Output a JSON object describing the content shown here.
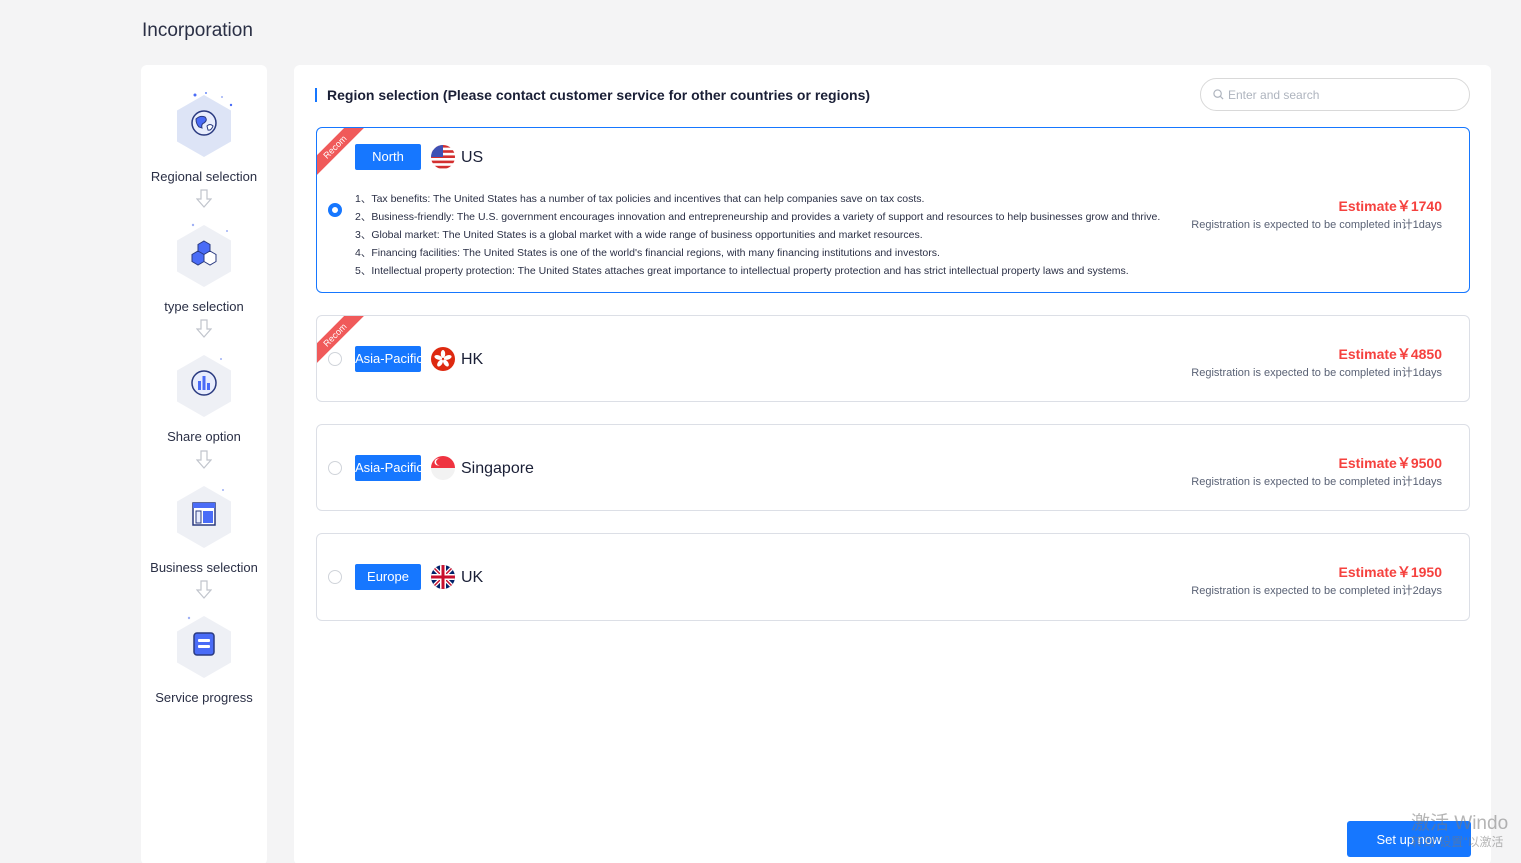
{
  "page": {
    "title": "Incorporation"
  },
  "sidebar": {
    "steps": [
      {
        "label": "Regional selection",
        "icon": "globe-icon"
      },
      {
        "label": "type selection",
        "icon": "hexagons-icon"
      },
      {
        "label": "Share option",
        "icon": "bar-chart-icon"
      },
      {
        "label": "Business selection",
        "icon": "layout-icon"
      },
      {
        "label": "Service progress",
        "icon": "document-icon"
      }
    ]
  },
  "main": {
    "section_title": "Region selection (Please contact customer service for other countries or regions)",
    "search": {
      "placeholder": "Enter and search",
      "value": ""
    },
    "ribbon_text": "Recom",
    "regions": [
      {
        "tag": "North",
        "country": "US",
        "flag": "us-flag-icon",
        "recommended": true,
        "selected": true,
        "details": [
          "1、Tax benefits: The United States has a number of tax policies and incentives that can help companies save on tax costs.",
          "2、Business-friendly: The U.S. government encourages innovation and entrepreneurship and provides a variety of support and resources to help businesses grow and thrive.",
          "3、Global market: The United States is a global market with a wide range of business opportunities and market resources.",
          "4、Financing facilities: The United States is one of the world's financial regions, with many financing institutions and investors.",
          "5、Intellectual property protection: The United States attaches great importance to intellectual property protection and has strict intellectual property laws and systems."
        ],
        "price": "Estimate￥1740",
        "eta": "Registration is expected to be completed in计1days"
      },
      {
        "tag": "Asia-Pacific",
        "country": "HK",
        "flag": "hk-flag-icon",
        "recommended": true,
        "selected": false,
        "price": "Estimate￥4850",
        "eta": "Registration is expected to be completed in计1days"
      },
      {
        "tag": "Asia-Pacific",
        "country": "Singapore",
        "flag": "sg-flag-icon",
        "recommended": false,
        "selected": false,
        "price": "Estimate￥9500",
        "eta": "Registration is expected to be completed in计1days"
      },
      {
        "tag": "Europe",
        "country": "UK",
        "flag": "uk-flag-icon",
        "recommended": false,
        "selected": false,
        "price": "Estimate￥1950",
        "eta": "Registration is expected to be completed in计2days"
      }
    ]
  },
  "footer": {
    "setup_label": "Set up now"
  },
  "watermark": {
    "line1": "激活 Windo",
    "line2": "转到\"设置\"以激活"
  },
  "colors": {
    "accent": "#1677ff",
    "price": "#f5413e",
    "ribbon": "#f05a5a"
  }
}
